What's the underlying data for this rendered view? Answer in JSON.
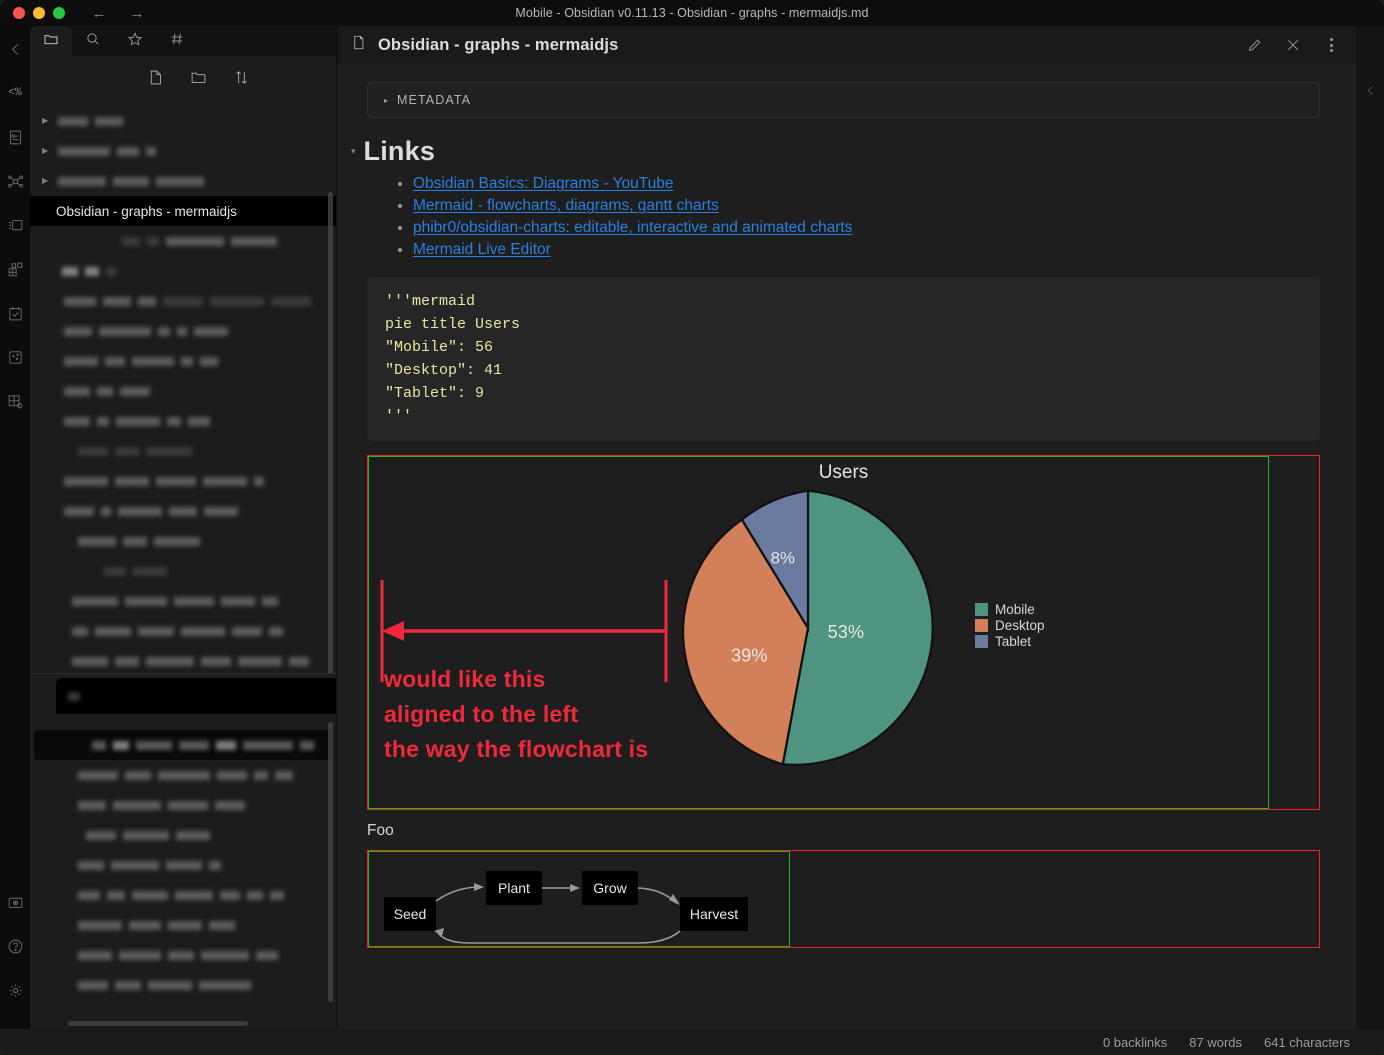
{
  "window": {
    "title": "Mobile - Obsidian v0.11.13 - Obsidian - graphs - mermaidjs.md",
    "back_icon": "←",
    "forward_icon": "→"
  },
  "ribbon": {
    "collapse_label": "‹",
    "items": [
      {
        "name": "collapse-left-icon",
        "label": "‹"
      },
      {
        "name": "code-percent-icon",
        "label": "<%"
      },
      {
        "name": "template-note-icon",
        "label": ""
      },
      {
        "name": "graph-view-icon",
        "label": ""
      },
      {
        "name": "cards-icon",
        "label": ""
      },
      {
        "name": "kanban-icon",
        "label": ""
      },
      {
        "name": "calendar-check-icon",
        "label": ""
      },
      {
        "name": "canvas-icon",
        "label": ""
      },
      {
        "name": "database-settings-icon",
        "label": ""
      }
    ],
    "bottom_items": [
      {
        "name": "screenshot-icon"
      },
      {
        "name": "help-icon",
        "label": "?"
      },
      {
        "name": "settings-gear-icon"
      }
    ]
  },
  "sidebar": {
    "tabs": [
      {
        "name": "files-tab",
        "icon": "folder-icon",
        "active": true
      },
      {
        "name": "search-tab",
        "icon": "search-icon",
        "active": false
      },
      {
        "name": "starred-tab",
        "icon": "star-icon",
        "active": false
      },
      {
        "name": "tags-tab",
        "icon": "hash-icon",
        "active": false
      }
    ],
    "toolbar": [
      {
        "name": "new-note-button",
        "icon": "new-file-icon"
      },
      {
        "name": "new-folder-button",
        "icon": "new-folder-icon"
      },
      {
        "name": "change-sort-order-button",
        "icon": "sort-icon"
      }
    ],
    "selected_file": "Obsidian - graphs - mermaidjs"
  },
  "main": {
    "doc_title": "Obsidian - graphs - mermaidjs",
    "actions": [
      {
        "name": "edit-button",
        "icon": "pencil-icon"
      },
      {
        "name": "close-button",
        "icon": "close-icon"
      },
      {
        "name": "more-options-button",
        "icon": "vertical-dots-icon"
      }
    ],
    "metadata": {
      "caret": "▸",
      "label": "METADATA"
    },
    "links_section": {
      "caret": "▾",
      "heading": "Links",
      "items": [
        "Obsidian Basics: Diagrams - YouTube",
        "Mermaid - flowcharts, diagrams, gantt charts",
        "phibr0/obsidian-charts: editable, interactive and animated charts",
        "Mermaid Live Editor"
      ]
    },
    "code_block": "'''mermaid\npie title Users\n\"Mobile\": 56\n\"Desktop\": 41\n\"Tablet\": 9\n'''",
    "annotation": {
      "line1": "would like this",
      "line2": "aligned to the left",
      "line3": "the way the flowchart is",
      "color": "#f0283c"
    },
    "foo_label": "Foo",
    "flowchart": {
      "nodes": [
        "Seed",
        "Plant",
        "Grow",
        "Harvest"
      ]
    },
    "boxes": {
      "outer_color": "#ef2222",
      "inner_color": "#17c017"
    }
  },
  "chart_data": {
    "type": "pie",
    "title": "Users",
    "categories": [
      "Mobile",
      "Desktop",
      "Tablet"
    ],
    "values": [
      56,
      41,
      9
    ],
    "percent_labels": [
      "53%",
      "39%",
      "8%"
    ],
    "colors": [
      "#4f9381",
      "#d2805a",
      "#6b7ba0"
    ],
    "legend_position": "right",
    "xlabel": "",
    "ylabel": ""
  },
  "statusbar": {
    "backlinks": "0 backlinks",
    "words": "87 words",
    "characters": "641 characters"
  }
}
